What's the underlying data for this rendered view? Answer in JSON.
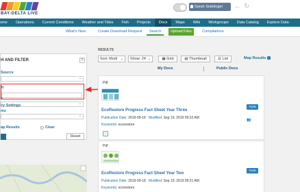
{
  "header": {
    "logo_text": "BAY-DELTA LIVE",
    "user_label": "Sarah Sodologer",
    "back_icon": "arrow-left-icon",
    "refresh_icon": "refresh-icon",
    "logo_colors": [
      "#e23b2e",
      "#f39a1e",
      "#f6cd23",
      "#4fa83d",
      "#2d7fc2",
      "#6b3fa0"
    ]
  },
  "main_nav": [
    "ome",
    "Operations",
    "Current Conditions",
    "Weather and Tides",
    "Fish",
    "Projects",
    "Docs",
    "Maps",
    "Wiki",
    "Workgroups",
    "Data Catalog",
    "Explore Data"
  ],
  "main_nav_active": "Docs",
  "sub_nav": {
    "whats_new": "What's New",
    "create_download": "Create Download Request",
    "search": "Search",
    "upload": "Upload Files",
    "compilations": "Compilations"
  },
  "left_panel": {
    "title": "H AND FILTER",
    "help": "?",
    "source_label": "Source",
    "keyword_label": "h",
    "label3": "e",
    "label4": "ms",
    "policy_label": "cy Settings",
    "map_results_label": "ap Results",
    "clear_label": "Clear",
    "reset_button": "Reset"
  },
  "results": {
    "label": "RESULTS",
    "sort_value": "Sort: Modi",
    "show_value": "Show: 24",
    "grid_label": "Grid",
    "thumbnail_label": "Thumbnail",
    "list_label": "List",
    "map_results": "Map Results",
    "my_docs": "My Docs",
    "public_docs": "Public Docs"
  },
  "cards": [
    {
      "type": "Pdf",
      "title": "EcoRestore Progress Fact Sheet Year Three",
      "pub_label": "Publication Date:",
      "pub_date": "2019-09-18",
      "mod_label": "Modified:",
      "mod_date": "Sep 19, 2019 09:22 AM",
      "kw_label": "Keywords:",
      "keywords": "ecorestore",
      "tools": "Tools"
    },
    {
      "type": "Pdf",
      "title": "EcoRestore Progress Fact Sheet Year Two",
      "pub_label": "Publication Date:",
      "pub_date": "2019-09-18",
      "mod_label": "Modified:",
      "mod_date": "Sep 19, 2019 09:21 AM",
      "kw_label": "Keywords:",
      "keywords": "ecorestore",
      "tools": "Tools"
    }
  ]
}
